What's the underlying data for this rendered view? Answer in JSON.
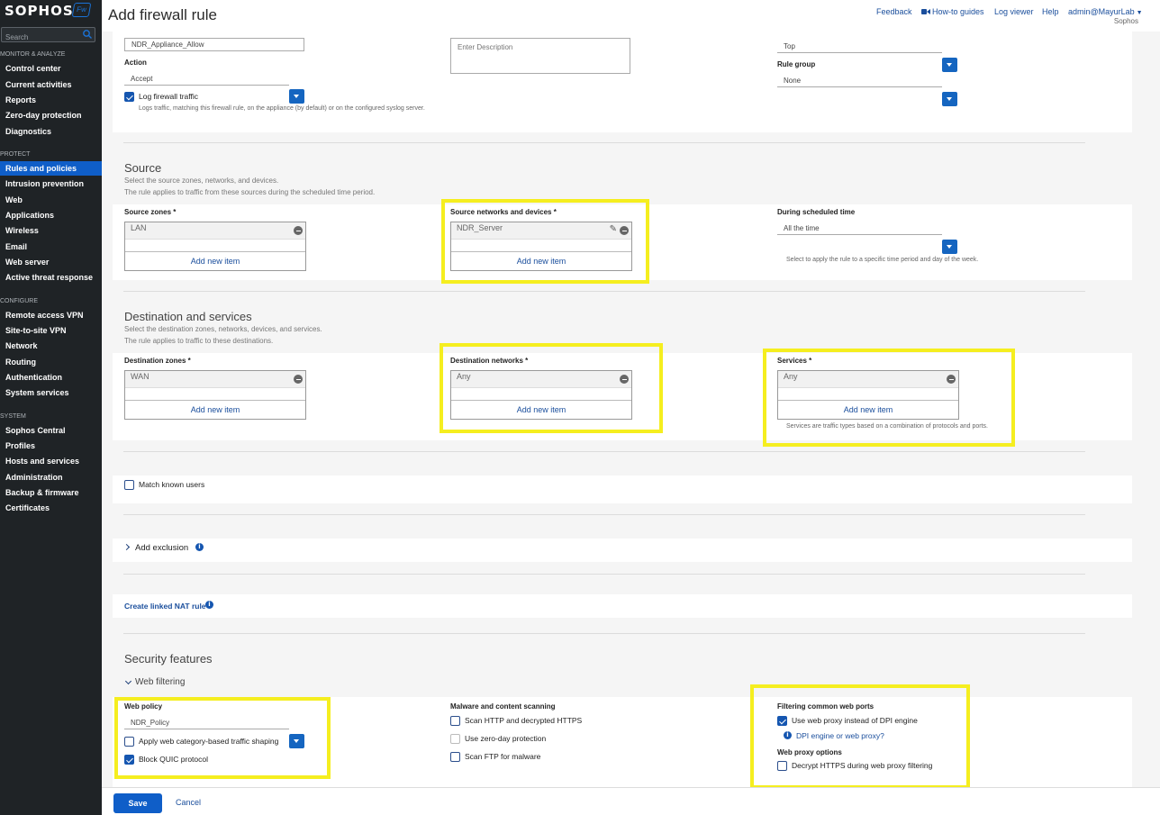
{
  "sidebar": {
    "logo": "SOPHOS",
    "logo_badge": "Fw",
    "search_placeholder": "Search",
    "sections": [
      {
        "title": "MONITOR & ANALYZE",
        "items": [
          "Control center",
          "Current activities",
          "Reports",
          "Zero-day protection",
          "Diagnostics"
        ]
      },
      {
        "title": "PROTECT",
        "items": [
          "Rules and policies",
          "Intrusion prevention",
          "Web",
          "Applications",
          "Wireless",
          "Email",
          "Web server",
          "Active threat response"
        ]
      },
      {
        "title": "CONFIGURE",
        "items": [
          "Remote access VPN",
          "Site-to-site VPN",
          "Network",
          "Routing",
          "Authentication",
          "System services"
        ]
      },
      {
        "title": "SYSTEM",
        "items": [
          "Sophos Central",
          "Profiles",
          "Hosts and services",
          "Administration",
          "Backup & firmware",
          "Certificates"
        ]
      }
    ],
    "active_item": "Rules and policies"
  },
  "header": {
    "title": "Add firewall rule",
    "links": {
      "feedback": "Feedback",
      "howto": "How-to guides",
      "logviewer": "Log viewer",
      "help": "Help",
      "user": "admin@MayurLab"
    },
    "org": "Sophos"
  },
  "top": {
    "rule_name": "NDR_Appliance_Allow",
    "action_label": "Action",
    "action_value": "Accept",
    "log_label": "Log firewall traffic",
    "log_checked": true,
    "log_hint": "Logs traffic, matching this firewall rule, on the appliance (by default) or on the configured syslog server.",
    "description_placeholder": "Enter Description",
    "position_value": "Top",
    "rule_group_label": "Rule group",
    "rule_group_value": "None"
  },
  "source": {
    "title": "Source",
    "desc1": "Select the source zones, networks, and devices.",
    "desc2": "The rule applies to traffic from these sources during the scheduled time period.",
    "zones_label": "Source zones *",
    "zones_value": "LAN",
    "networks_label": "Source networks and devices *",
    "networks_value": "NDR_Server",
    "schedule_label": "During scheduled time",
    "schedule_value": "All the time",
    "schedule_hint": "Select to apply the rule to a specific time period and day of the week.",
    "add_new": "Add new item"
  },
  "destination": {
    "title": "Destination and services",
    "desc1": "Select the destination zones, networks, devices, and services.",
    "desc2": "The rule applies to traffic to these destinations.",
    "zones_label": "Destination zones *",
    "zones_value": "WAN",
    "networks_label": "Destination networks *",
    "networks_value": "Any",
    "services_label": "Services *",
    "services_value": "Any",
    "services_hint": "Services are traffic types based on a combination of protocols and ports.",
    "add_new": "Add new item"
  },
  "match_users": {
    "label": "Match known users",
    "checked": false
  },
  "exclusion": {
    "label": "Add exclusion"
  },
  "nat": {
    "label": "Create linked NAT rule"
  },
  "security": {
    "title": "Security features",
    "web_filtering": "Web filtering",
    "web_policy_label": "Web policy",
    "web_policy_value": "NDR_Policy",
    "traffic_shaping_label": "Apply web category-based traffic shaping",
    "traffic_shaping_checked": false,
    "block_quic_label": "Block QUIC protocol",
    "block_quic_checked": true,
    "malware_label": "Malware and content scanning",
    "scan_http_label": "Scan HTTP and decrypted HTTPS",
    "zero_day_label": "Use zero-day protection",
    "scan_ftp_label": "Scan FTP for malware",
    "ports_label": "Filtering common web ports",
    "use_proxy_label": "Use web proxy instead of DPI engine",
    "use_proxy_checked": true,
    "dpi_link": "DPI engine or web proxy?",
    "proxy_options_label": "Web proxy options",
    "decrypt_label": "Decrypt HTTPS during web proxy filtering"
  },
  "footer": {
    "save": "Save",
    "cancel": "Cancel"
  },
  "colors": {
    "sidebar_bg": "#1f2326",
    "active": "#0f5ec8",
    "highlight": "#f5ee1f",
    "link": "#1a4e9c"
  }
}
